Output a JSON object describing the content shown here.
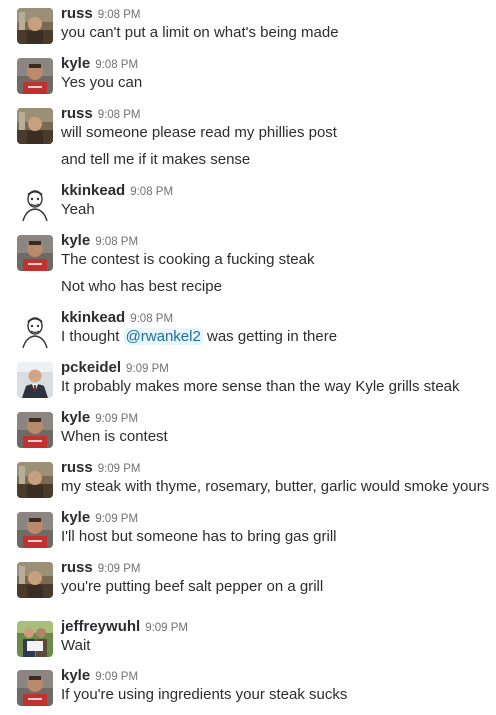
{
  "messages": [
    {
      "user": "russ",
      "time": "9:08 PM",
      "avatar": "russ",
      "lines": [
        [
          "you can't put a limit on what's being made"
        ]
      ]
    },
    {
      "user": "kyle",
      "time": "9:08 PM",
      "avatar": "kyle",
      "lines": [
        [
          "Yes you can"
        ]
      ]
    },
    {
      "user": "russ",
      "time": "9:08 PM",
      "avatar": "russ",
      "lines": [
        [
          "will someone please read my phillies post"
        ],
        [
          "and tell me if it makes sense"
        ]
      ]
    },
    {
      "user": "kkinkead",
      "time": "9:08 PM",
      "avatar": "kkinkead",
      "lines": [
        [
          "Yeah"
        ]
      ]
    },
    {
      "user": "kyle",
      "time": "9:08 PM",
      "avatar": "kyle",
      "lines": [
        [
          "The contest is cooking a fucking steak"
        ],
        [
          "Not who has best recipe"
        ]
      ]
    },
    {
      "user": "kkinkead",
      "time": "9:08 PM",
      "avatar": "kkinkead",
      "lines": [
        [
          "I thought ",
          "@rwankel2",
          " was getting in there"
        ]
      ]
    },
    {
      "user": "pckeidel",
      "time": "9:09 PM",
      "avatar": "pckeidel",
      "lines": [
        [
          "It probably makes more sense than the way Kyle grills steak"
        ]
      ]
    },
    {
      "user": "kyle",
      "time": "9:09 PM",
      "avatar": "kyle",
      "lines": [
        [
          "When is contest"
        ]
      ]
    },
    {
      "user": "russ",
      "time": "9:09 PM",
      "avatar": "russ",
      "lines": [
        [
          "my steak with thyme, rosemary, butter, garlic would smoke yours"
        ]
      ]
    },
    {
      "user": "kyle",
      "time": "9:09 PM",
      "avatar": "kyle",
      "lines": [
        [
          "I'll host but someone has to bring gas grill"
        ]
      ]
    },
    {
      "user": "russ",
      "time": "9:09 PM",
      "avatar": "russ",
      "lines": [
        [
          "you're putting beef salt pepper on a grill"
        ]
      ]
    },
    {
      "user": "jeffreywuhl",
      "time": "9:09 PM",
      "avatar": "jeffreywuhl",
      "lines": [
        [
          "Wait"
        ]
      ]
    },
    {
      "user": "kyle",
      "time": "9:09 PM",
      "avatar": "kyle",
      "lines": [
        [
          "If you're using ingredients your steak sucks"
        ]
      ]
    }
  ],
  "colors": {
    "text": "#2c2d30",
    "timestamp": "#717274",
    "mention": "#1d6fa5",
    "mention_bg": "#e8f5fa"
  }
}
